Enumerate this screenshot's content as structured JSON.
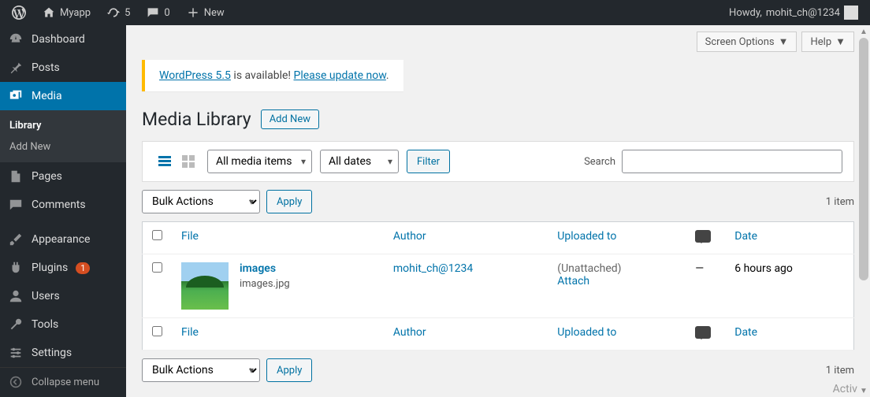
{
  "adminbar": {
    "site_name": "Myapp",
    "updates_count": "5",
    "comments_count": "0",
    "new_label": "New",
    "howdy_prefix": "Howdy, ",
    "username": "mohit_ch@1234"
  },
  "menu": {
    "dashboard": "Dashboard",
    "posts": "Posts",
    "media": "Media",
    "pages": "Pages",
    "comments": "Comments",
    "appearance": "Appearance",
    "plugins": "Plugins",
    "plugins_badge": "1",
    "users": "Users",
    "tools": "Tools",
    "settings": "Settings",
    "collapse": "Collapse menu"
  },
  "submenu": {
    "library": "Library",
    "add_new": "Add New"
  },
  "topbuttons": {
    "screen_options": "Screen Options",
    "help": "Help"
  },
  "update_nag": {
    "link1": "WordPress 5.5",
    "middle": " is available! ",
    "link2": "Please update now",
    "end": "."
  },
  "header": {
    "title": "Media Library",
    "add_new": "Add New"
  },
  "filters": {
    "media_type": "All media items",
    "dates": "All dates",
    "filter_btn": "Filter",
    "search_label": "Search"
  },
  "bulk": {
    "label": "Bulk Actions",
    "apply": "Apply"
  },
  "count": {
    "items": "1 item"
  },
  "columns": {
    "file": "File",
    "author": "Author",
    "uploaded_to": "Uploaded to",
    "date": "Date"
  },
  "rows": [
    {
      "title": "images",
      "filename": "images.jpg",
      "author": "mohit_ch@1234",
      "uploaded_to": "(Unattached)",
      "attach_link": "Attach",
      "comments": "—",
      "date": "6 hours ago"
    }
  ],
  "watermark": "Activat"
}
